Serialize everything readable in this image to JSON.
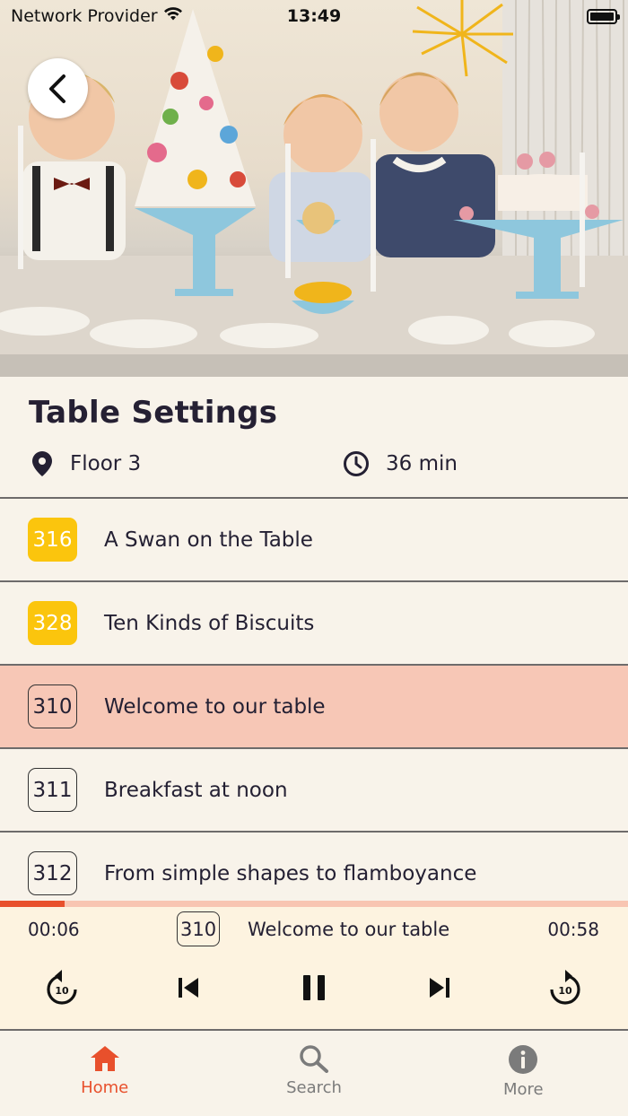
{
  "status_bar": {
    "carrier": "Network Provider",
    "time": "13:49"
  },
  "tour": {
    "title": "Table Settings",
    "location": "Floor 3",
    "duration": "36 min"
  },
  "stops": [
    {
      "number": "316",
      "title": "A Swan on the Table",
      "style": "filled",
      "active": false
    },
    {
      "number": "328",
      "title": "Ten Kinds of Biscuits",
      "style": "filled",
      "active": false
    },
    {
      "number": "310",
      "title": "Welcome to our table",
      "style": "outline",
      "active": true
    },
    {
      "number": "311",
      "title": "Breakfast at noon",
      "style": "outline",
      "active": false
    },
    {
      "number": "312",
      "title": "From simple shapes to flamboyance",
      "style": "outline",
      "active": false
    }
  ],
  "player": {
    "elapsed": "00:06",
    "total": "00:58",
    "progress_fraction": 0.103,
    "now_playing_number": "310",
    "now_playing_title": "Welcome to our table",
    "rewind_icon": "replay-10-icon",
    "forward_icon": "forward-10-icon"
  },
  "tab_bar": {
    "tabs": [
      {
        "label": "Home",
        "icon": "home-icon",
        "selected": true
      },
      {
        "label": "Search",
        "icon": "search-icon",
        "selected": false
      },
      {
        "label": "More",
        "icon": "info-icon",
        "selected": false
      }
    ]
  },
  "colors": {
    "accent": "#e8502c",
    "badge_yellow": "#fbc50d",
    "active_row": "#f7c7b6",
    "player_bg": "#fdf3e0",
    "background": "#f8f3ea",
    "text": "#242033"
  }
}
